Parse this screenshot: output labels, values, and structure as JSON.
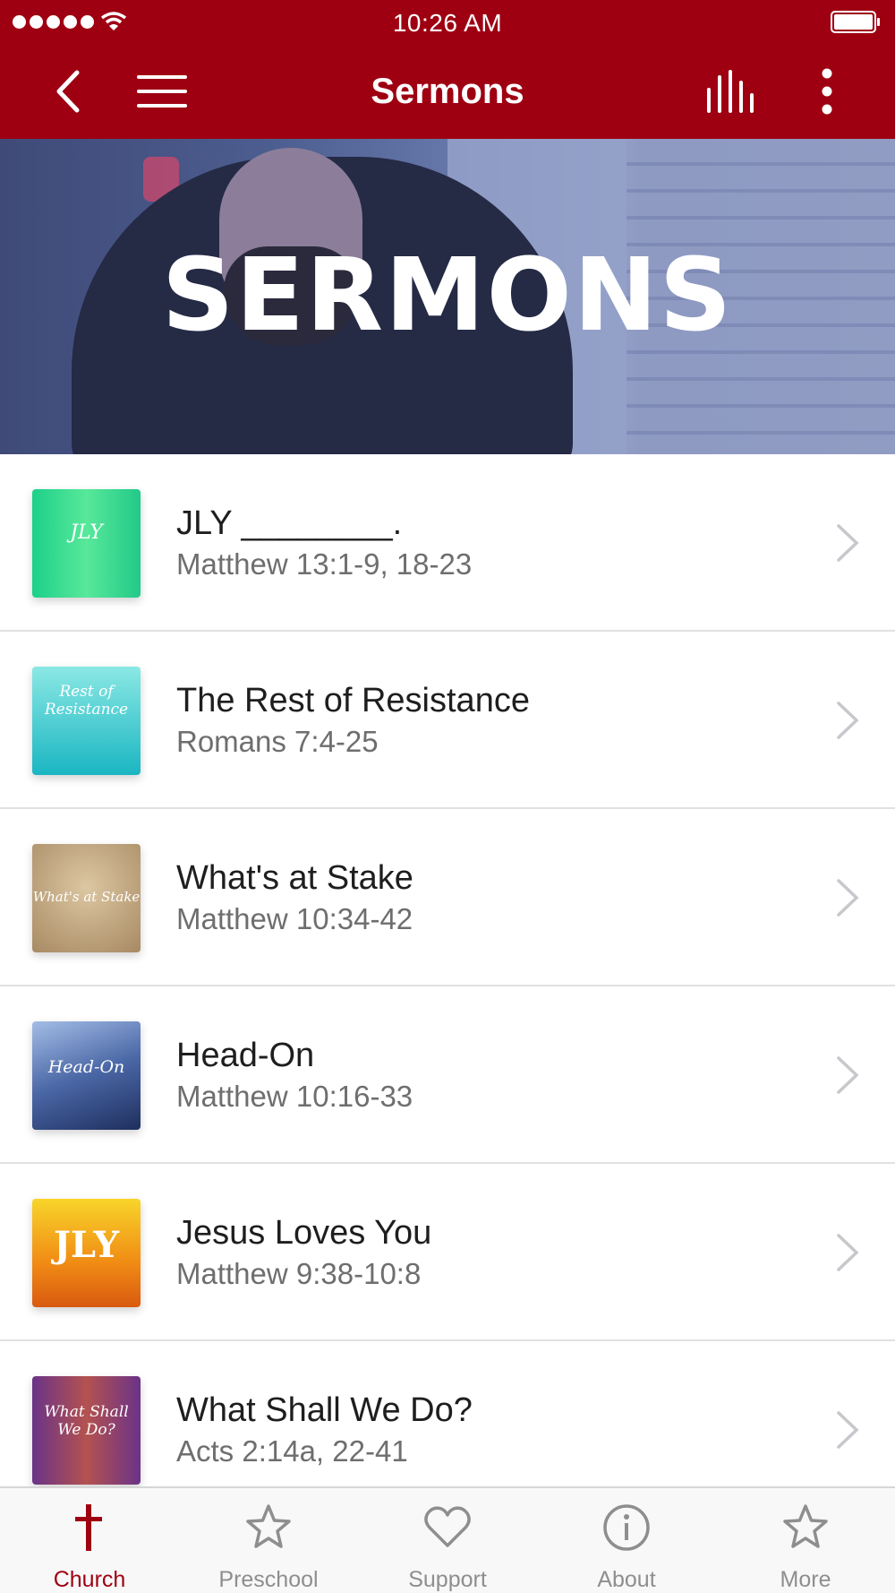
{
  "status_bar": {
    "time": "10:26 AM"
  },
  "nav": {
    "title": "Sermons"
  },
  "banner": {
    "title": "SERMONS"
  },
  "sermons": [
    {
      "title": "JLY ________.",
      "passage": "Matthew 13:1-9, 18-23",
      "thumb_text": "JLY",
      "thumb_colors": [
        "#1dd089",
        "#58e89a"
      ]
    },
    {
      "title": "The Rest of Resistance",
      "passage": "Romans 7:4-25",
      "thumb_text": "Rest of Resistance",
      "thumb_colors": [
        "#6fdfe0",
        "#1ab6c2"
      ]
    },
    {
      "title": "What's at Stake",
      "passage": "Matthew 10:34-42",
      "thumb_text": "What's at Stake",
      "thumb_colors": [
        "#c9b08a",
        "#a78a63"
      ]
    },
    {
      "title": "Head-On",
      "passage": "Matthew 10:16-33",
      "thumb_text": "Head-On",
      "thumb_colors": [
        "#6d8cc4",
        "#23386e"
      ]
    },
    {
      "title": "Jesus Loves You",
      "passage": "Matthew 9:38-10:8",
      "thumb_text": "JLY",
      "thumb_colors": [
        "#f6c21c",
        "#e26a12"
      ]
    },
    {
      "title": "What Shall We Do?",
      "passage": "Acts 2:14a, 22-41",
      "thumb_text": "What Shall We Do?",
      "thumb_colors": [
        "#7a3c8c",
        "#c45a4e"
      ]
    }
  ],
  "tabs": [
    {
      "label": "Church",
      "icon": "cross-icon",
      "active": true
    },
    {
      "label": "Preschool",
      "icon": "star-icon",
      "active": false
    },
    {
      "label": "Support",
      "icon": "heart-icon",
      "active": false
    },
    {
      "label": "About",
      "icon": "info-icon",
      "active": false
    },
    {
      "label": "More",
      "icon": "star-icon",
      "active": false
    }
  ],
  "colors": {
    "brand": "#9e0012",
    "tab_inactive": "#8e8e8e"
  }
}
